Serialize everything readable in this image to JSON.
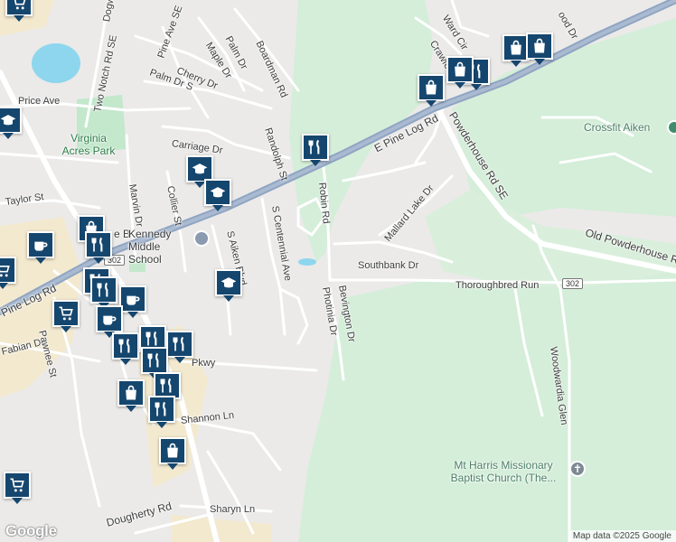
{
  "map": {
    "streets": [
      {
        "text": "Dogwood Dr",
        "id": "dogwood-dr"
      },
      {
        "text": "Pine Ave SE",
        "id": "pine-ave-se"
      },
      {
        "text": "Palm Dr",
        "id": "palm-dr"
      },
      {
        "text": "Maple Dr",
        "id": "maple-dr"
      },
      {
        "text": "Boardman Rd",
        "id": "boardman-rd"
      },
      {
        "text": "Two Notch Rd SE",
        "id": "two-notch-rd-se"
      },
      {
        "text": "Cherry Dr",
        "id": "cherry-dr"
      },
      {
        "text": "Palm Dr S",
        "id": "palm-dr-s"
      },
      {
        "text": "Price Ave",
        "id": "price-ave"
      },
      {
        "text": "Randolph St",
        "id": "randolph-st"
      },
      {
        "text": "Carriage Dr",
        "id": "carriage-dr"
      },
      {
        "text": "Taylor St",
        "id": "taylor-st"
      },
      {
        "text": "Marvin Dr",
        "id": "marvin-dr"
      },
      {
        "text": "Collier St",
        "id": "collier-st"
      },
      {
        "text": "S Aiken Blvd",
        "id": "s-aiken-blvd"
      },
      {
        "text": "S Centennial Ave",
        "id": "s-centennial-ave"
      },
      {
        "text": "Robin Rd",
        "id": "robin-rd"
      },
      {
        "text": "Mallard Lake Dr",
        "id": "mallard-lake-dr"
      },
      {
        "text": "Southbank Dr",
        "id": "southbank-dr"
      },
      {
        "text": "Photinia Dr",
        "id": "photinia-dr"
      },
      {
        "text": "Bevington Dr",
        "id": "bevington-dr"
      },
      {
        "text": "Thoroughbred Run",
        "id": "thoroughbred-run"
      },
      {
        "text": "Old Powderhouse Rd",
        "id": "old-powderhouse-rd"
      },
      {
        "text": "Woodwardia Glen",
        "id": "woodwardia-glen"
      },
      {
        "text": "Powderhouse Rd SE",
        "id": "powderhouse-rd-se"
      },
      {
        "text": "E Pine Log Rd",
        "id": "e-pine-log-rd"
      },
      {
        "text": "Pine Log Rd",
        "id": "pine-log-rd"
      },
      {
        "text": "Fabian Dr",
        "id": "fabian-dr"
      },
      {
        "text": "Pawnee St",
        "id": "pawnee-st"
      },
      {
        "text": "Pkwy",
        "id": "pkwy"
      },
      {
        "text": "Shannon Ln",
        "id": "shannon-ln"
      },
      {
        "text": "Sharyn Ln",
        "id": "sharyn-ln"
      },
      {
        "text": "Dougherty Rd",
        "id": "dougherty-rd"
      },
      {
        "text": "Ward Cir",
        "id": "ward-cir"
      },
      {
        "text": "Crawford",
        "id": "crawford"
      },
      {
        "text": "ood Dr",
        "id": "ood-dr"
      }
    ],
    "places": {
      "park": "Virginia Acres Park",
      "school": "Kennedy Middle School",
      "school_prefix": "e B",
      "gym": "Crossfit Aiken",
      "church": "Mt Harris Missionary Baptist Church (The..."
    },
    "shields": {
      "route_302_a": "302",
      "route_302_b": "302"
    },
    "attribution": "Map data ©2025 Google",
    "logo": "Google",
    "colors": {
      "pin": "#15466e",
      "park": "#c3e8cc",
      "green": "#d4eed9",
      "water": "#8ed6ee",
      "road": "#ffffff",
      "highway": "#8fa5c2",
      "commercial": "#f2e9cf"
    },
    "pins": [
      {
        "id": "shopping-1",
        "icon": "shopping-bag-icon"
      },
      {
        "id": "restaurant-1",
        "icon": "restaurant-icon"
      },
      {
        "id": "school-1",
        "icon": "school-icon"
      },
      {
        "id": "cafe-1",
        "icon": "coffee-cup-icon"
      },
      {
        "id": "grocery-1",
        "icon": "shopping-cart-icon"
      }
    ]
  }
}
